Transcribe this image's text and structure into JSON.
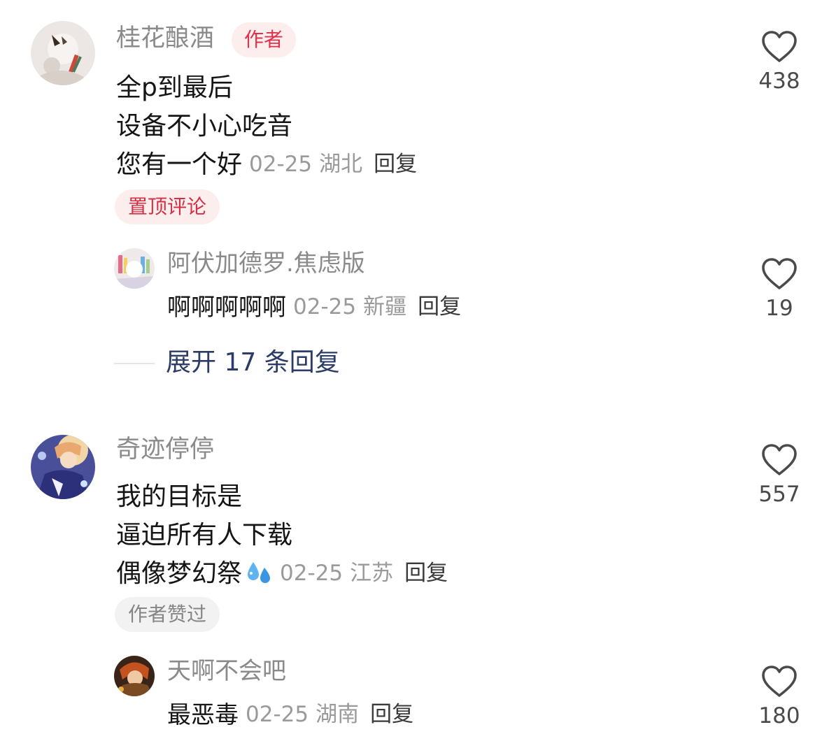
{
  "comments": [
    {
      "username": "桂花酿酒",
      "author_tag": "作者",
      "lines": [
        "全p到最后",
        "设备不小心吃音",
        "您有一个好"
      ],
      "date": "02-25",
      "location": "湖北",
      "reply_label": "回复",
      "badge": "置顶评论",
      "likes": "438",
      "replies": [
        {
          "username": "阿伏加德罗.焦虑版",
          "text": "啊啊啊啊啊",
          "date": "02-25",
          "location": "新疆",
          "reply_label": "回复",
          "likes": "19"
        }
      ],
      "expand_label": "展开 17 条回复"
    },
    {
      "username": "奇迹停停",
      "lines": [
        "我的目标是",
        "逼迫所有人下载",
        "偶像梦幻祭"
      ],
      "emoji": "sweat-droplets-icon",
      "date": "02-25",
      "location": "江苏",
      "reply_label": "回复",
      "badge": "作者赞过",
      "likes": "557",
      "replies": [
        {
          "username": "天啊不会吧",
          "text": "最恶毒",
          "date": "02-25",
          "location": "湖南",
          "reply_label": "回复",
          "likes": "180"
        }
      ]
    }
  ],
  "colors": {
    "pinned_badge_bg": "#fdeeee",
    "pinned_badge_text": "#d42f45",
    "expand_text": "#2b3d66",
    "username": "#8a8a8a",
    "meta": "#9a9a9a"
  }
}
